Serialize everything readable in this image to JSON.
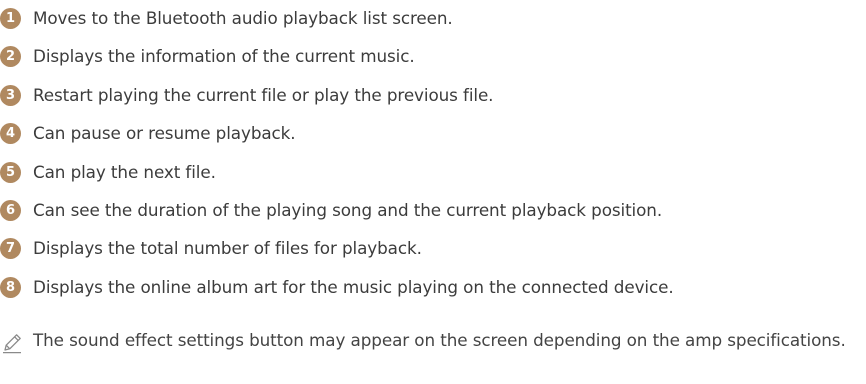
{
  "accent_color": "#b08960",
  "items": [
    {
      "number": "1",
      "text": "Moves to the Bluetooth audio playback list screen."
    },
    {
      "number": "2",
      "text": "Displays the information of the current music."
    },
    {
      "number": "3",
      "text": "Restart playing the current file or play the previous file."
    },
    {
      "number": "4",
      "text": "Can pause or resume playback."
    },
    {
      "number": "5",
      "text": "Can play the next file."
    },
    {
      "number": "6",
      "text": "Can see the duration of the playing song and the current playback position."
    },
    {
      "number": "7",
      "text": "Displays the total number of files for playback."
    },
    {
      "number": "8",
      "text": "Displays the online album art for the music playing on the connected device."
    }
  ],
  "note": {
    "icon": "pencil-icon",
    "text": "The sound effect settings button may appear on the screen depending on the amp specifications."
  }
}
